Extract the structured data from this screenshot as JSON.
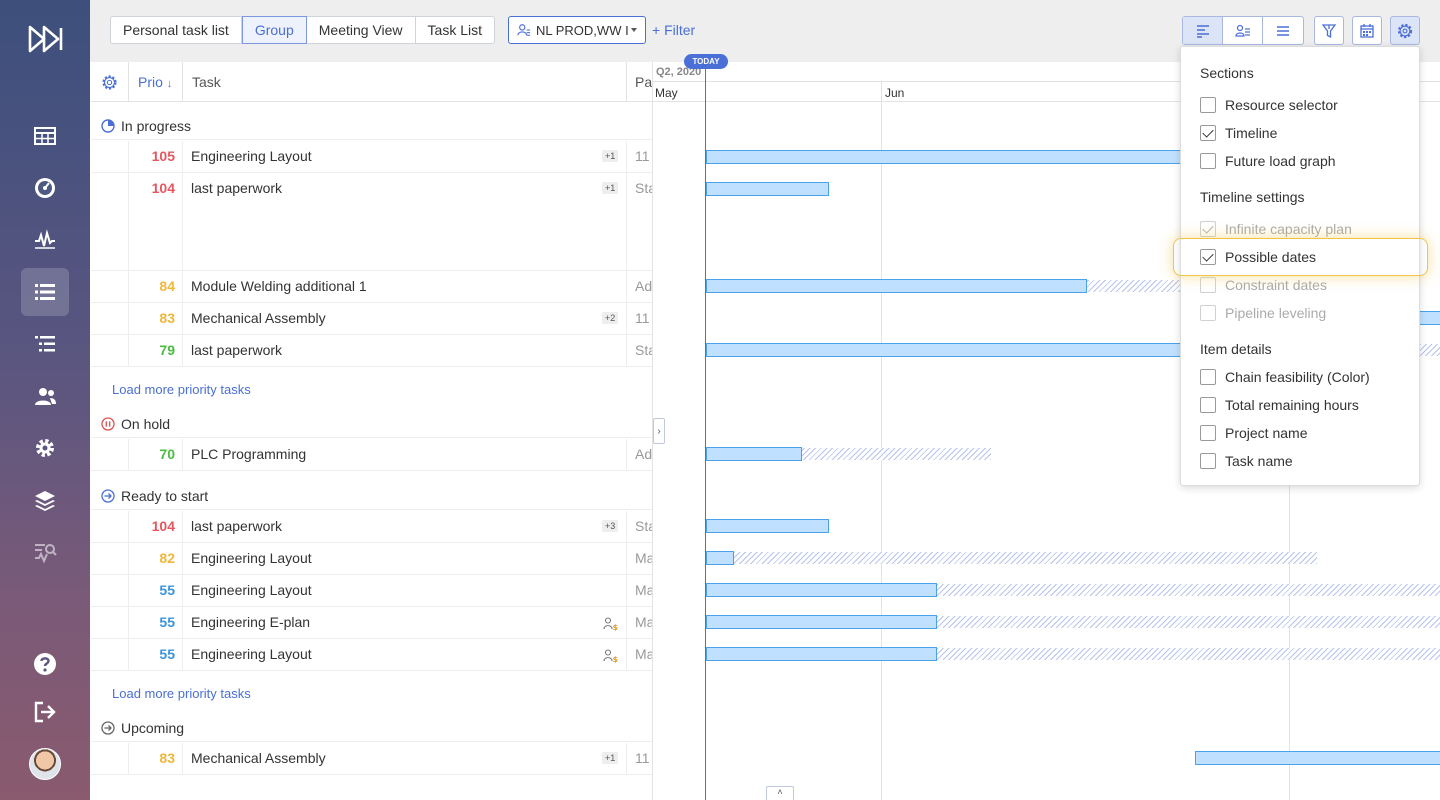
{
  "toolbar": {
    "view_tabs": [
      {
        "label": "Personal task list",
        "active": false
      },
      {
        "label": "Group",
        "active": true
      },
      {
        "label": "Meeting View",
        "active": false
      },
      {
        "label": "Task List",
        "active": false
      }
    ],
    "group_select": "NL PROD,WW I",
    "filter_label": "+ Filter"
  },
  "list_header": {
    "prio_label": "Prio",
    "task_label": "Task",
    "pa_label": "Pa"
  },
  "sections": [
    {
      "title": "In progress"
    },
    {
      "title": "On hold"
    },
    {
      "title": "Ready to start"
    },
    {
      "title": "Upcoming"
    }
  ],
  "tasks": [
    {
      "prio": "105",
      "name": "Engineering Layout",
      "badge": "+1",
      "pa": "11"
    },
    {
      "prio": "104",
      "name": "last paperwork",
      "badge": "+1",
      "pa": "Sta"
    },
    {
      "prio": "84",
      "name": "Module Welding additional 1",
      "badge": "",
      "pa": "Ad"
    },
    {
      "prio": "83",
      "name": "Mechanical Assembly",
      "badge": "+2",
      "pa": "11"
    },
    {
      "prio": "79",
      "name": "last paperwork",
      "badge": "",
      "pa": "Sta"
    },
    {
      "prio": "70",
      "name": "PLC Programming",
      "badge": "",
      "pa": "Ad"
    },
    {
      "prio": "104",
      "name": "last paperwork",
      "badge": "+3",
      "pa": "Sta"
    },
    {
      "prio": "82",
      "name": "Engineering Layout",
      "badge": "",
      "pa": "Ma"
    },
    {
      "prio": "55",
      "name": "Engineering Layout",
      "badge": "",
      "pa": "Ma"
    },
    {
      "prio": "55",
      "name": "Engineering E-plan",
      "badge": "",
      "pa": "Ma"
    },
    {
      "prio": "55",
      "name": "Engineering Layout",
      "badge": "",
      "pa": "Ma"
    },
    {
      "prio": "83",
      "name": "Mechanical Assembly",
      "badge": "+1",
      "pa": "11"
    }
  ],
  "load_more_label": "Load more priority tasks",
  "timeline": {
    "quarter": "Q2, 2020",
    "today": "TODAY",
    "months": [
      "May",
      "Jun"
    ]
  },
  "settings_menu": {
    "sections_heading": "Sections",
    "sections_items": [
      {
        "label": "Resource selector",
        "checked": false
      },
      {
        "label": "Timeline",
        "checked": true
      },
      {
        "label": "Future load graph",
        "checked": false
      }
    ],
    "timeline_heading": "Timeline settings",
    "timeline_items": [
      {
        "label": "Infinite capacity plan",
        "checked": true,
        "disabled": true
      },
      {
        "label": "Possible dates",
        "checked": true,
        "disabled": false
      },
      {
        "label": "Constraint dates",
        "checked": false,
        "disabled": true
      },
      {
        "label": "Pipeline leveling",
        "checked": false,
        "disabled": true
      }
    ],
    "details_heading": "Item details",
    "details_items": [
      {
        "label": "Chain feasibility (Color)",
        "checked": false
      },
      {
        "label": "Total remaining hours",
        "checked": false
      },
      {
        "label": "Project name",
        "checked": false
      },
      {
        "label": "Task name",
        "checked": false
      }
    ]
  },
  "colors": {
    "accent": "#4a6fd6",
    "prio_red": "#e8575f",
    "prio_yellow": "#f0b73a",
    "prio_green": "#4bbb42",
    "prio_blue": "#3a95e0",
    "bar_fill": "#bfe0ff",
    "highlight": "#f0c44a"
  },
  "icons": [
    "app-logo-icon",
    "grid-icon",
    "dashboard-icon",
    "pulse-icon",
    "list-icon",
    "tree-list-icon",
    "users-icon",
    "gear-icon",
    "layers-icon",
    "analytics-icon",
    "help-icon",
    "logout-icon",
    "settings-gear-icon",
    "resource-icon"
  ]
}
